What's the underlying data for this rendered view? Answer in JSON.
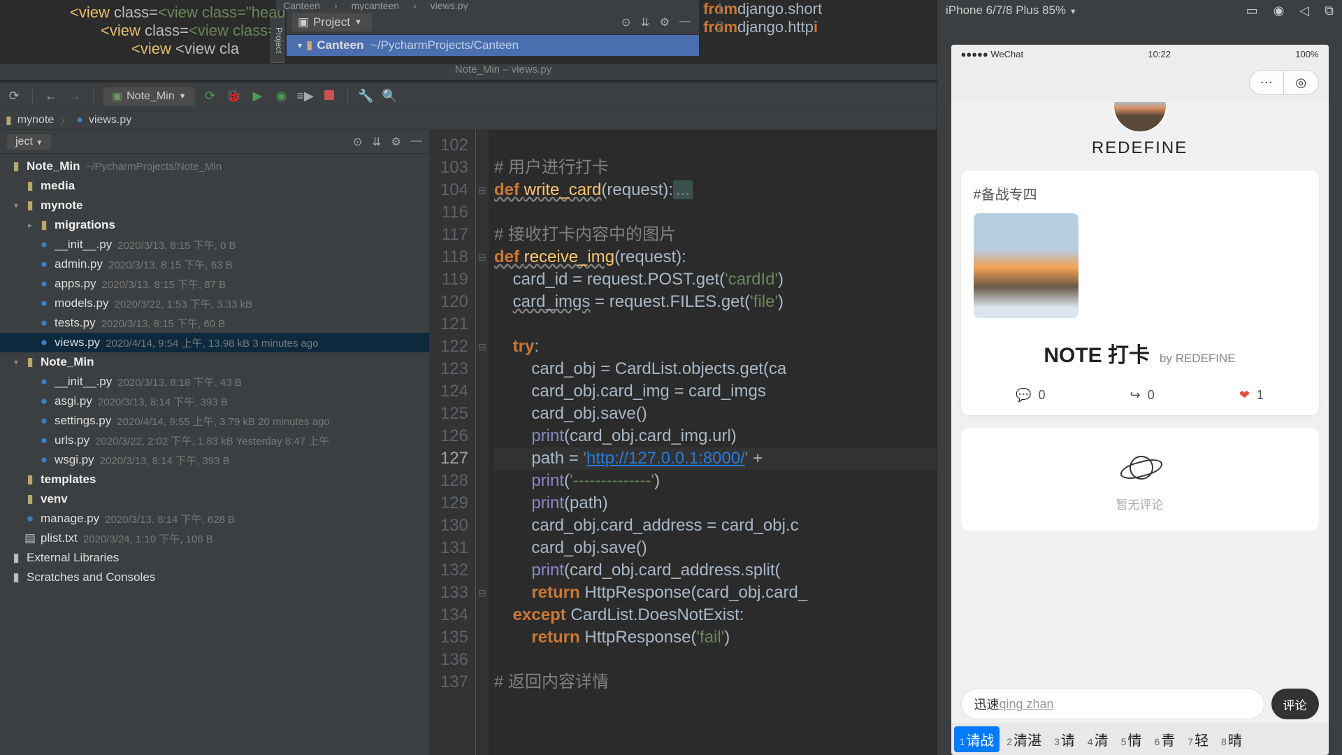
{
  "bg_code": {
    "l1": "<view class=\"head",
    "l2": "<view class=\"",
    "l3": "<view cla"
  },
  "top": {
    "tabs": [
      "Canteen",
      "mycanteen",
      "views.py"
    ],
    "project_label": "Project",
    "tree_root": "Canteen",
    "tree_root_path": "~/PycharmProjects/Canteen",
    "editor": {
      "l1_num": "1",
      "l1": "from django.short",
      "l2_num": "2",
      "l2": "from django.http i"
    },
    "title": "Note_Min – views.py"
  },
  "toolbar": {
    "run_config": "Note_Min"
  },
  "breadcrumb": [
    "mynote",
    "views.py"
  ],
  "tree": {
    "dropdown": "ject",
    "items": [
      {
        "ind": "ind1",
        "type": "root",
        "name": "Note_Min",
        "meta": "~/PycharmProjects/Note_Min"
      },
      {
        "ind": "ind2",
        "type": "fldr",
        "name": "media",
        "chev": ""
      },
      {
        "ind": "ind2",
        "type": "fldr",
        "name": "mynote",
        "chev": "▾"
      },
      {
        "ind": "ind3",
        "type": "fldr",
        "name": "migrations",
        "chev": "▸"
      },
      {
        "ind": "ind3",
        "type": "py",
        "name": "__init__.py",
        "meta": "2020/3/13, 8:15 下午, 0 B"
      },
      {
        "ind": "ind3",
        "type": "py",
        "name": "admin.py",
        "meta": "2020/3/13, 8:15 下午, 63 B"
      },
      {
        "ind": "ind3",
        "type": "py",
        "name": "apps.py",
        "meta": "2020/3/13, 8:15 下午, 87 B"
      },
      {
        "ind": "ind3",
        "type": "py",
        "name": "models.py",
        "meta": "2020/3/22, 1:53 下午, 3.33 kB"
      },
      {
        "ind": "ind3",
        "type": "py",
        "name": "tests.py",
        "meta": "2020/3/13, 8:15 下午, 60 B"
      },
      {
        "ind": "ind3",
        "type": "py",
        "name": "views.py",
        "meta": "2020/4/14, 9:54 上午, 13.98 kB 3 minutes ago",
        "sel": true
      },
      {
        "ind": "ind2",
        "type": "fldr",
        "name": "Note_Min",
        "chev": "▾"
      },
      {
        "ind": "ind3",
        "type": "py",
        "name": "__init__.py",
        "meta": "2020/3/13, 8:18 下午, 43 B"
      },
      {
        "ind": "ind3",
        "type": "py",
        "name": "asgi.py",
        "meta": "2020/3/13, 8:14 下午, 393 B"
      },
      {
        "ind": "ind3",
        "type": "py",
        "name": "settings.py",
        "meta": "2020/4/14, 9:55 上午, 3.79 kB 20 minutes ago"
      },
      {
        "ind": "ind3",
        "type": "py",
        "name": "urls.py",
        "meta": "2020/3/22, 2:02 下午, 1.83 kB Yesterday 8:47 上午"
      },
      {
        "ind": "ind3",
        "type": "py",
        "name": "wsgi.py",
        "meta": "2020/3/13, 8:14 下午, 393 B"
      },
      {
        "ind": "ind2",
        "type": "fldr",
        "name": "templates",
        "chev": ""
      },
      {
        "ind": "ind2",
        "type": "fldr",
        "name": "venv",
        "chev": ""
      },
      {
        "ind": "ind2",
        "type": "py",
        "name": "manage.py",
        "meta": "2020/3/13, 8:14 下午, 628 B"
      },
      {
        "ind": "ind2",
        "type": "txt",
        "name": "plist.txt",
        "meta": "2020/3/24, 1:10 下午, 106 B"
      },
      {
        "ind": "ind1",
        "type": "lib",
        "name": "External Libraries"
      },
      {
        "ind": "ind1",
        "type": "lib",
        "name": "Scratches and Consoles"
      }
    ]
  },
  "editor": {
    "lines": [
      {
        "n": 102,
        "t": ""
      },
      {
        "n": 103,
        "t": "# 用户进行打卡",
        "cls": "cmt"
      },
      {
        "n": 104,
        "seg": [
          {
            "c": "kw undash",
            "t": "def "
          },
          {
            "c": "fn undash",
            "t": "write_card"
          },
          {
            "c": "",
            "t": "(request):"
          },
          {
            "c": "folded",
            "t": "..."
          }
        ]
      },
      {
        "n": 116,
        "t": ""
      },
      {
        "n": 117,
        "t": "# 接收打卡内容中的图片",
        "cls": "cmt"
      },
      {
        "n": 118,
        "seg": [
          {
            "c": "kw undash",
            "t": "def "
          },
          {
            "c": "fn undash",
            "t": "receive_img"
          },
          {
            "c": "",
            "t": "(request):"
          }
        ]
      },
      {
        "n": 119,
        "seg": [
          {
            "c": "",
            "t": "    card_id = request.POST.get("
          },
          {
            "c": "str",
            "t": "'cardId'"
          },
          {
            "c": "",
            "t": ")"
          }
        ]
      },
      {
        "n": 120,
        "seg": [
          {
            "c": "",
            "t": "    "
          },
          {
            "c": "undash",
            "t": "card_imgs"
          },
          {
            "c": "",
            "t": " = request.FILES.get("
          },
          {
            "c": "str",
            "t": "'file'"
          },
          {
            "c": "",
            "t": ")"
          }
        ]
      },
      {
        "n": 121,
        "t": ""
      },
      {
        "n": 122,
        "seg": [
          {
            "c": "",
            "t": "    "
          },
          {
            "c": "kw",
            "t": "try"
          },
          {
            "c": "",
            "t": ":"
          }
        ]
      },
      {
        "n": 123,
        "seg": [
          {
            "c": "",
            "t": "        card_obj = CardList.objects.get("
          },
          {
            "c": "",
            "t": "ca"
          }
        ]
      },
      {
        "n": 124,
        "seg": [
          {
            "c": "",
            "t": "        card_obj.card_img = card_imgs"
          }
        ]
      },
      {
        "n": 125,
        "seg": [
          {
            "c": "",
            "t": "        card_obj.save()"
          }
        ]
      },
      {
        "n": 126,
        "seg": [
          {
            "c": "",
            "t": "        "
          },
          {
            "c": "builtin",
            "t": "print"
          },
          {
            "c": "",
            "t": "(card_obj.card_img.url)"
          }
        ]
      },
      {
        "n": 127,
        "cur": true,
        "seg": [
          {
            "c": "",
            "t": "        path = "
          },
          {
            "c": "str",
            "t": "'"
          },
          {
            "c": "url",
            "t": "http://127.0.0.1:8000/"
          },
          {
            "c": "str",
            "t": "'"
          },
          {
            "c": "",
            "t": " +"
          }
        ]
      },
      {
        "n": 128,
        "seg": [
          {
            "c": "",
            "t": "        "
          },
          {
            "c": "builtin",
            "t": "print"
          },
          {
            "c": "",
            "t": "("
          },
          {
            "c": "str",
            "t": "'--------------'"
          },
          {
            "c": "",
            "t": ")"
          }
        ]
      },
      {
        "n": 129,
        "seg": [
          {
            "c": "",
            "t": "        "
          },
          {
            "c": "builtin",
            "t": "print"
          },
          {
            "c": "",
            "t": "(path)"
          }
        ]
      },
      {
        "n": 130,
        "seg": [
          {
            "c": "",
            "t": "        card_obj.card_address = card_obj.c"
          }
        ]
      },
      {
        "n": 131,
        "seg": [
          {
            "c": "",
            "t": "        card_obj.save()"
          }
        ]
      },
      {
        "n": 132,
        "seg": [
          {
            "c": "",
            "t": "        "
          },
          {
            "c": "builtin",
            "t": "print"
          },
          {
            "c": "",
            "t": "(card_obj.card_address.split("
          }
        ]
      },
      {
        "n": 133,
        "seg": [
          {
            "c": "",
            "t": "        "
          },
          {
            "c": "kw",
            "t": "return"
          },
          {
            "c": "",
            "t": " HttpResponse(card_obj.card_"
          }
        ]
      },
      {
        "n": 134,
        "seg": [
          {
            "c": "",
            "t": "    "
          },
          {
            "c": "kw",
            "t": "except"
          },
          {
            "c": "",
            "t": " CardList.DoesNotExist:"
          }
        ]
      },
      {
        "n": 135,
        "seg": [
          {
            "c": "",
            "t": "        "
          },
          {
            "c": "kw",
            "t": "return"
          },
          {
            "c": "",
            "t": " HttpResponse("
          },
          {
            "c": "str",
            "t": "'fail'"
          },
          {
            "c": "",
            "t": ")"
          }
        ]
      },
      {
        "n": 136,
        "t": ""
      },
      {
        "n": 137,
        "t": "# 返回内容详情",
        "cls": "cmt"
      }
    ]
  },
  "emu": {
    "device": "iPhone 6/7/8 Plus 85%",
    "status_left": "●●●●● WeChat",
    "status_time": "10:22",
    "status_right": "100%",
    "username": "REDEFINE",
    "topic": "#备战专四",
    "note_title": "NOTE 打卡",
    "note_by": "by REDEFINE",
    "comments": "0",
    "shares": "0",
    "likes": "1",
    "empty": "暂无评论",
    "input_typed": "迅速",
    "input_suggest": "qing zhan",
    "comment_btn": "评论",
    "ime": [
      {
        "n": "1",
        "t": "请战",
        "sel": true
      },
      {
        "n": "2",
        "t": "清湛"
      },
      {
        "n": "3",
        "t": "请"
      },
      {
        "n": "4",
        "t": "清"
      },
      {
        "n": "5",
        "t": "情"
      },
      {
        "n": "6",
        "t": "青"
      },
      {
        "n": "7",
        "t": "轻"
      },
      {
        "n": "8",
        "t": "晴"
      }
    ]
  }
}
